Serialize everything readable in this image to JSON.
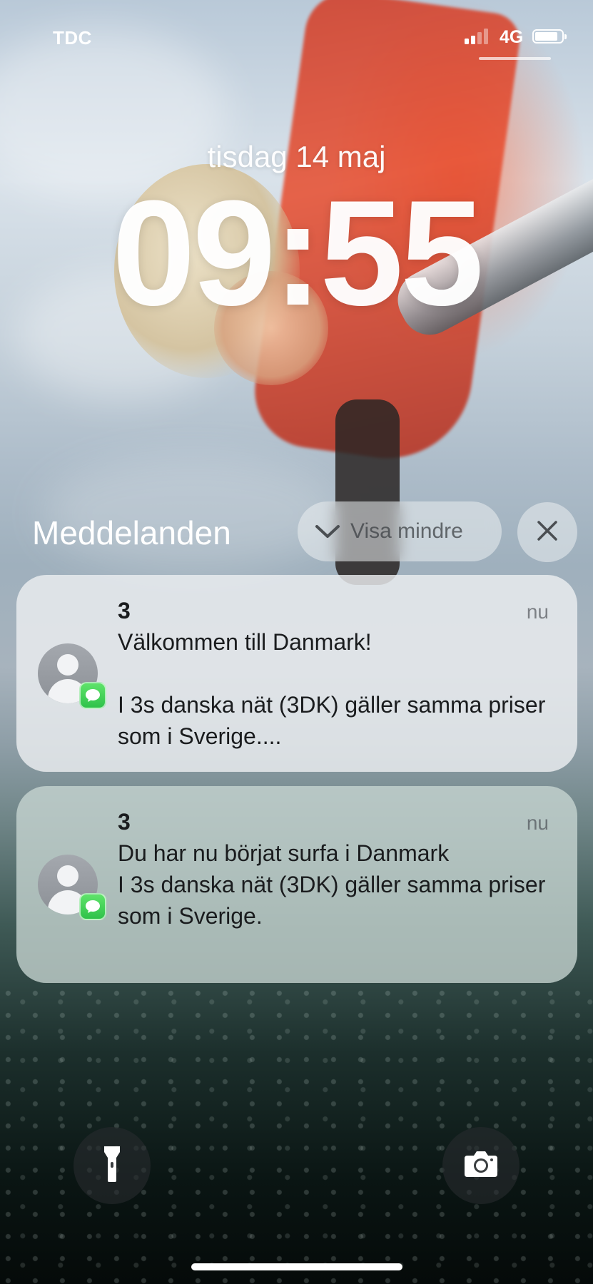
{
  "status_bar": {
    "carrier": "TDC",
    "network": "4G",
    "signal_bars_active": 2,
    "signal_bars_total": 4,
    "battery_level": 0.85
  },
  "lock_screen": {
    "date": "tisdag 14 maj",
    "time": "09:55"
  },
  "notifications_header": {
    "title": "Meddelanden",
    "show_less_label": "Visa mindre"
  },
  "notifications": [
    {
      "sender": "3",
      "time": "nu",
      "message": "Välkommen till Danmark!\n\nI 3s danska nät (3DK) gäller samma priser som i Sverige....",
      "app_icon": "messages-icon"
    },
    {
      "sender": "3",
      "time": "nu",
      "message": "Du har nu börjat surfa i Danmark\nI 3s danska nät (3DK) gäller samma priser som i Sverige.",
      "app_icon": "messages-icon"
    }
  ],
  "quick_actions": {
    "left_icon": "flashlight-icon",
    "right_icon": "camera-icon"
  },
  "colors": {
    "messages_green": "#34c759",
    "notification_bg": "#eceef0"
  }
}
